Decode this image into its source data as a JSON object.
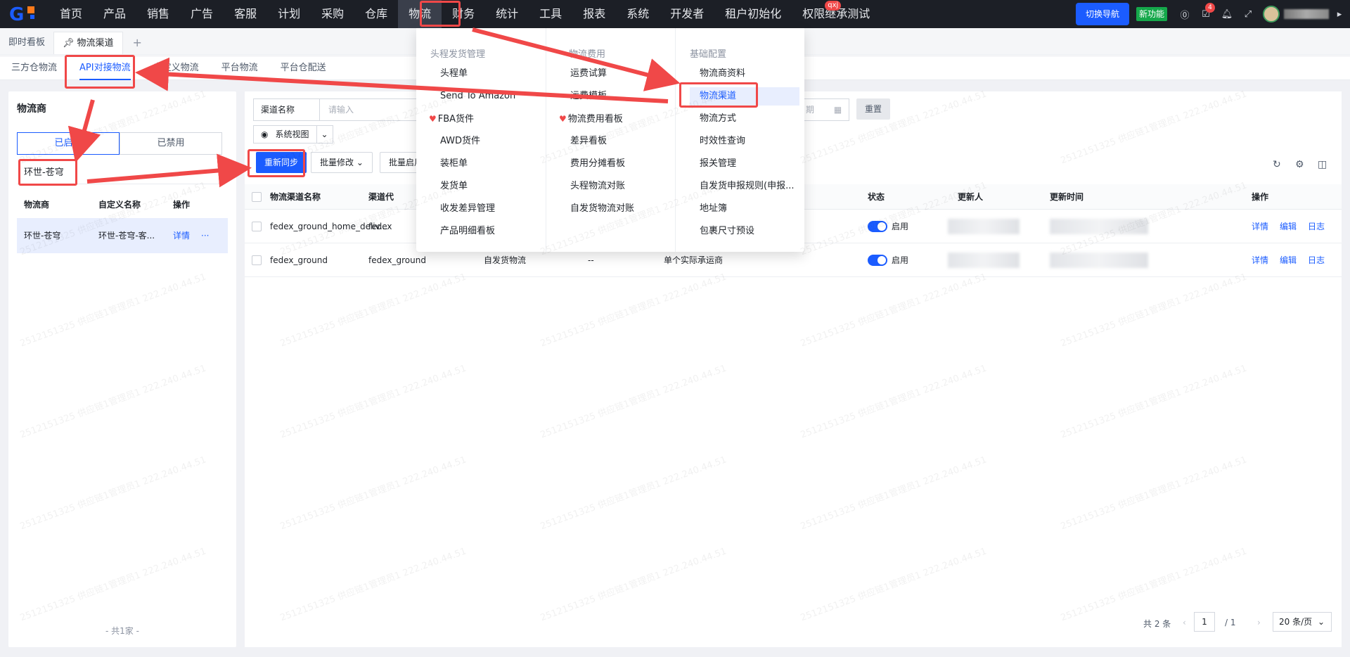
{
  "topnav": {
    "items": [
      "首页",
      "产品",
      "销售",
      "广告",
      "客服",
      "计划",
      "采购",
      "仓库",
      "物流",
      "财务",
      "统计",
      "工具",
      "报表",
      "系统",
      "开发者",
      "租户初始化",
      "权限继承测试"
    ],
    "active": "物流",
    "user_badge": "qxj",
    "switch_nav": "切换导航",
    "new_feature": "新功能",
    "task_count": "4"
  },
  "page_tabs": [
    "即时看板",
    "物流渠道"
  ],
  "subtabs": [
    "三方仓物流",
    "API对接物流",
    "自定义物流",
    "平台物流",
    "平台仓配送"
  ],
  "left": {
    "title": "物流商",
    "seg_enabled": "已启用",
    "seg_disabled": "已禁用",
    "search_value": "环世-苍穹",
    "headers": [
      "物流商",
      "自定义名称",
      "操作"
    ],
    "row": {
      "provider": "环世-苍穹",
      "custom": "环世-苍穹-客...",
      "action": "详情",
      "more": "···"
    },
    "total": "- 共1家 -"
  },
  "filters": {
    "channel_key": "渠道名称",
    "channel_placeholder": "请输入",
    "date_placeholder": "期",
    "reset": "重置",
    "view": "系统视图"
  },
  "actions": {
    "resync": "重新同步",
    "batch_modify": "批量修改",
    "batch_enable": "批量启用"
  },
  "table": {
    "headers": {
      "name": "物流渠道名称",
      "code": "渠道代",
      "status": "状态",
      "updater": "更新人",
      "updated": "更新时间",
      "ops": "操作"
    },
    "rows": [
      {
        "name": "fedex_ground_home_deliv...",
        "code": "fedex",
        "type": "",
        "dash": "",
        "carrier": "",
        "status": "启用",
        "ops": [
          "详情",
          "编辑",
          "日志"
        ]
      },
      {
        "name": "fedex_ground",
        "code": "fedex_ground",
        "type": "自发货物流",
        "dash": "--",
        "carrier": "单个实际承运商",
        "status": "启用",
        "ops": [
          "详情",
          "编辑",
          "日志"
        ]
      }
    ]
  },
  "pager": {
    "total": "共 2 条",
    "page": "1",
    "pages": "/ 1",
    "size": "20 条/页"
  },
  "menu": {
    "col1_title": "头程发货管理",
    "col1": [
      "头程单",
      "Send To Amazon",
      "FBA货件",
      "AWD货件",
      "装柜单",
      "发货单",
      "收发差异管理",
      "产品明细看板"
    ],
    "col2_title": "物流费用",
    "col2": [
      "运费试算",
      "运费模板",
      "物流费用看板",
      "差异看板",
      "费用分摊看板",
      "头程物流对账",
      "自发货物流对账"
    ],
    "col3_title": "基础配置",
    "col3": [
      "物流商资料",
      "物流渠道",
      "物流方式",
      "时效性查询",
      "报关管理",
      "自发货申报规则(申报...",
      "地址簿",
      "包裹尺寸预设"
    ]
  },
  "watermark": "2512151325 供应链1管理员1 222.240.44.51",
  "colors": {
    "accent": "#1b5cff",
    "nav_bg": "#1c1f26",
    "annotation": "#f04848"
  }
}
